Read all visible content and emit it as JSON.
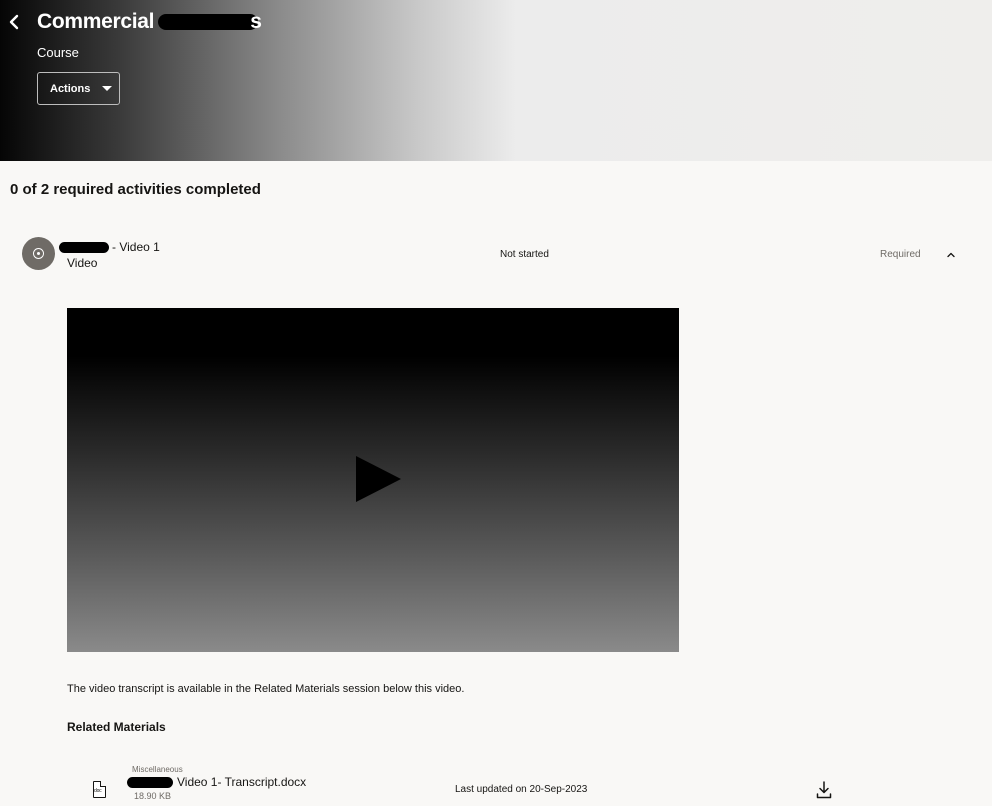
{
  "header": {
    "back_icon": "chevron-left-icon",
    "title_prefix": "Commercial",
    "title_suffix": "s",
    "subtitle": "Course",
    "actions_label": "Actions"
  },
  "progress": {
    "text": "0 of 2 required activities completed"
  },
  "activity": {
    "icon": "play-circle-icon",
    "name_suffix": "- Video 1",
    "type": "Video",
    "status": "Not started",
    "requirement": "Required",
    "toggle_icon": "chevron-up-icon"
  },
  "video": {
    "play_icon": "play-icon"
  },
  "content": {
    "transcript_note": "The video transcript is available in the Related Materials session below this video.",
    "related_heading": "Related Materials"
  },
  "material": {
    "icon": "docx-file-icon",
    "icon_label": "doc",
    "category": "Miscellaneous",
    "name_suffix": "Video 1- Transcript.docx",
    "size": "18.90 KB",
    "updated": "Last updated on 20-Sep-2023",
    "download_icon": "download-icon"
  }
}
